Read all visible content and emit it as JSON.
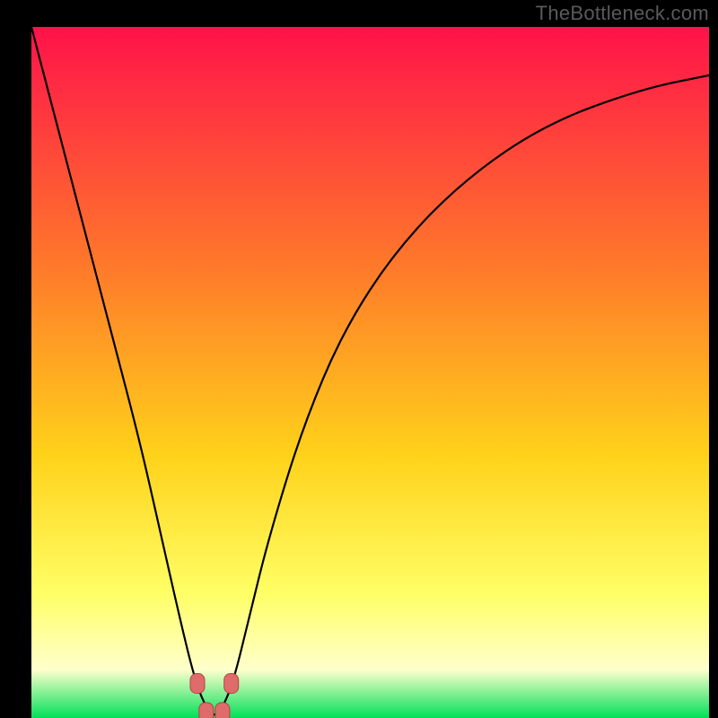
{
  "watermark": "TheBottleneck.com",
  "colors": {
    "bg_black": "#000000",
    "watermark_gray": "#5a5a5a",
    "grad_top": "#ff124a",
    "grad_upper_mid": "#ff7a2a",
    "grad_mid": "#ffd21a",
    "grad_lower_mid": "#ffff66",
    "grad_pale": "#ffffcc",
    "grad_bottom": "#00e058",
    "curve_stroke": "#000000",
    "marker_fill": "#e06b6b",
    "marker_stroke": "#b04545"
  },
  "chart_data": {
    "type": "line",
    "title": "",
    "xlabel": "",
    "ylabel": "",
    "xlim": [
      0,
      100
    ],
    "ylim": [
      0,
      100
    ],
    "grid": false,
    "legend": false,
    "series": [
      {
        "name": "bottleneck-curve",
        "x": [
          0,
          4,
          8,
          12,
          16,
          19,
          22,
          24,
          25.5,
          27,
          28.5,
          30,
          32,
          35,
          40,
          46,
          54,
          64,
          76,
          90,
          100
        ],
        "y": [
          100,
          85,
          70,
          55,
          40,
          27,
          14,
          6,
          2,
          0,
          2,
          6,
          14,
          26,
          42,
          56,
          68,
          78,
          86,
          91,
          93
        ]
      }
    ],
    "markers": [
      {
        "x": 24.5,
        "y": 5
      },
      {
        "x": 29.5,
        "y": 5
      },
      {
        "x": 25.8,
        "y": 0.8
      },
      {
        "x": 28.2,
        "y": 0.8
      }
    ],
    "annotations": []
  }
}
